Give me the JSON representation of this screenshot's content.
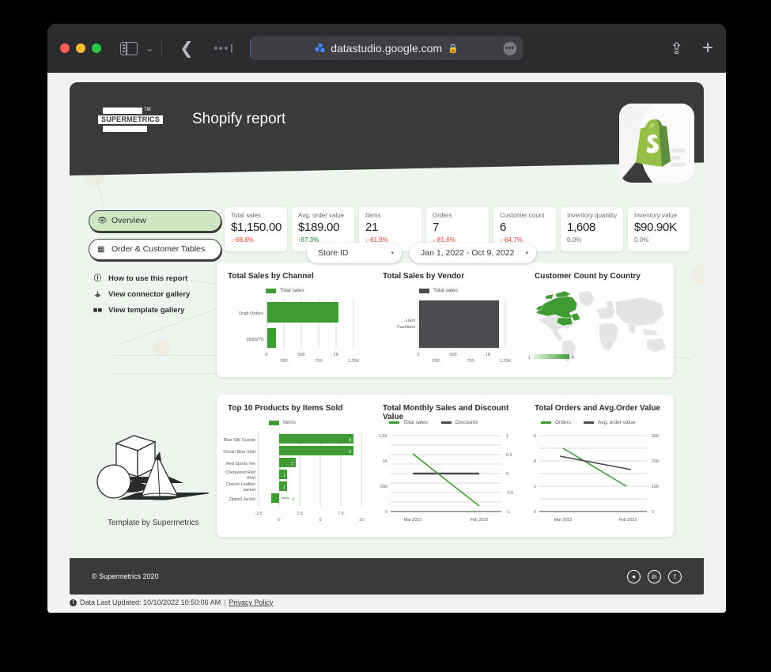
{
  "browser": {
    "url": "datastudio.google.com",
    "lock_icon": "lock-icon",
    "more_label": "•••",
    "sidebar_icon": "sidebar-toggle-icon",
    "back_icon": "back-arrow-icon",
    "share_icon": "share-icon",
    "new_tab_icon": "plus-icon",
    "shield_icon": "shield-icon",
    "traffic": [
      "close-button",
      "minimize-button",
      "maximize-button"
    ]
  },
  "report": {
    "title": "Shopify report",
    "logo_text": "SUPERMETRICS",
    "logo_tm": "TM",
    "filters": [
      {
        "label": "Store ID",
        "caret": "▾"
      },
      {
        "label": "Jan 1, 2022 - Oct 9, 2022",
        "caret": "▾"
      }
    ],
    "nav": {
      "pills": [
        {
          "label": "Overview",
          "icon": "eye-icon",
          "active": true
        },
        {
          "label": "Order & Customer Tables",
          "icon": "table-icon",
          "active": false
        }
      ],
      "links": [
        {
          "label": "How to use this report",
          "icon": "info-icon"
        },
        {
          "label": "View connector gallery",
          "icon": "plug-icon"
        },
        {
          "label": "View template gallery",
          "icon": "grid-icon"
        }
      ]
    },
    "template_caption": "Template by Supermetrics",
    "kpis": [
      {
        "label": "Total sales",
        "value": "$1,150.00",
        "delta": "-68.6%",
        "dir": "down",
        "arrow": "↓"
      },
      {
        "label": "Avg. order value",
        "value": "$189.00",
        "delta": "87.3%",
        "dir": "up",
        "arrow": "↑"
      },
      {
        "label": "Items",
        "value": "21",
        "delta": "-61.8%",
        "dir": "down",
        "arrow": "↓"
      },
      {
        "label": "Orders",
        "value": "7",
        "delta": "-81.6%",
        "dir": "down",
        "arrow": "↓"
      },
      {
        "label": "Customer count",
        "value": "6",
        "delta": "-64.7%",
        "dir": "down",
        "arrow": "↓"
      },
      {
        "label": "Inventory quantity",
        "value": "1,608",
        "delta": "0.0%",
        "dir": "flat",
        "arrow": ""
      },
      {
        "label": "Inventory value",
        "value": "$90.90K",
        "delta": "0.0%",
        "dir": "flat",
        "arrow": ""
      }
    ],
    "footer": {
      "copyright": "© Supermetrics 2020",
      "socials": [
        "twitter-icon",
        "linkedin-icon",
        "facebook-icon"
      ],
      "updated": "Data Last Updated: 10/10/2022 10:50:06 AM",
      "separator": "|",
      "privacy": "Privacy Policy"
    }
  },
  "colors": {
    "green": "#3f9c35",
    "dark": "#4a4a4f",
    "map_green": "#3f9c35",
    "map_grey": "#e4e4e4",
    "panel": "#ffffff",
    "bg": "#eef5ee",
    "header": "#3a3a3a",
    "down": "#e0422f",
    "up": "#1a8a2e"
  },
  "chart_data": [
    {
      "type": "bar",
      "title": "Total Sales by Channel",
      "orientation": "horizontal",
      "legend": [
        {
          "name": "Total sales",
          "color": "#3f9c35"
        }
      ],
      "legend_position": "top",
      "categories": [
        "Draft Orders",
        "1830279"
      ],
      "values": [
        1030,
        120
      ],
      "xlabel": "",
      "ylabel": "",
      "xlim": [
        0,
        1250
      ],
      "xticks": [
        0,
        250,
        500,
        750,
        1000,
        1250
      ],
      "xticklabels": [
        "0",
        "250",
        "500",
        "750",
        "1K",
        "1.25K"
      ],
      "grid": true
    },
    {
      "type": "bar",
      "title": "Total Sales by Vendor",
      "orientation": "horizontal",
      "legend": [
        {
          "name": "Total sales",
          "color": "#4a4a4f"
        }
      ],
      "legend_position": "top",
      "categories": [
        "Liam Fashions"
      ],
      "values": [
        1150
      ],
      "xlabel": "",
      "ylabel": "",
      "xlim": [
        0,
        1250
      ],
      "xticks": [
        0,
        250,
        500,
        750,
        1000,
        1250
      ],
      "xticklabels": [
        "0",
        "250",
        "500",
        "750",
        "1K",
        "1.25K"
      ],
      "grid": true
    },
    {
      "type": "heatmap",
      "subtype": "geo-choropleth",
      "title": "Customer Count by Country",
      "regions": [
        {
          "name": "Canada",
          "value": 4
        }
      ],
      "colorbar": {
        "min": "1",
        "max": "4",
        "low_color": "#eaf5e6",
        "high_color": "#3f9c35"
      }
    },
    {
      "type": "bar",
      "title": "Top 10 Products by Items Sold",
      "orientation": "horizontal",
      "legend": [
        {
          "name": "Items",
          "color": "#3f9c35"
        }
      ],
      "legend_position": "top",
      "categories": [
        "Blue Silk Tuxedo",
        "Ocean Blue Shirt",
        "Red Sports Tee",
        "Chequered Red Shirt",
        "Classic Leather Jacket",
        "Zipped Jacket"
      ],
      "values": [
        9,
        9,
        2,
        1,
        1,
        -1
      ],
      "data_labels": [
        "9",
        "9",
        "2",
        "1",
        "1",
        "-1"
      ],
      "xlabel": "",
      "ylabel": "",
      "xlim": [
        -2.5,
        10
      ],
      "xticks": [
        -2.5,
        0,
        2.5,
        5,
        7.5,
        10
      ],
      "xticklabels": [
        "-2.5",
        "0",
        "2.5",
        "5",
        "7.5",
        "10"
      ],
      "grid": true
    },
    {
      "type": "line",
      "title": "Total Monthly Sales and Discount Value",
      "x": [
        "Mar 2022",
        "Feb 2022"
      ],
      "series": [
        {
          "name": "Total sales",
          "color": "#3f9c35",
          "axis": "left",
          "values": [
            1050,
            100
          ]
        },
        {
          "name": "Discounts",
          "color": "#4a4a4f",
          "axis": "right",
          "values": [
            0,
            0
          ]
        }
      ],
      "left_axis": {
        "ticks": [
          0,
          500,
          1000,
          1500
        ],
        "ticklabels": [
          "0",
          "500",
          "1K",
          "1.5K"
        ],
        "lim": [
          0,
          1500
        ]
      },
      "right_axis": {
        "ticks": [
          -1,
          -0.5,
          0,
          0.5,
          1
        ],
        "ticklabels": [
          "-1",
          "-0.5",
          "0",
          "0.5",
          "1"
        ],
        "lim": [
          -1,
          1
        ]
      },
      "grid": true,
      "legend_position": "top"
    },
    {
      "type": "line",
      "title": "Total Orders and Avg.Order Value",
      "x": [
        "Mar 2022",
        "Feb 2022"
      ],
      "series": [
        {
          "name": "Orders",
          "color": "#3f9c35",
          "axis": "left",
          "values": [
            5,
            2
          ]
        },
        {
          "name": "Avg. order value",
          "color": "#4a4a4f",
          "axis": "right",
          "values": [
            230,
            195
          ]
        }
      ],
      "left_axis": {
        "ticks": [
          0,
          2,
          4,
          6
        ],
        "ticklabels": [
          "0",
          "2",
          "4",
          "6"
        ],
        "lim": [
          0,
          6
        ]
      },
      "right_axis": {
        "ticks": [
          0,
          100,
          200,
          300
        ],
        "ticklabels": [
          "0",
          "100",
          "200",
          "300"
        ],
        "lim": [
          0,
          300
        ]
      },
      "grid": true,
      "legend_position": "top"
    }
  ]
}
